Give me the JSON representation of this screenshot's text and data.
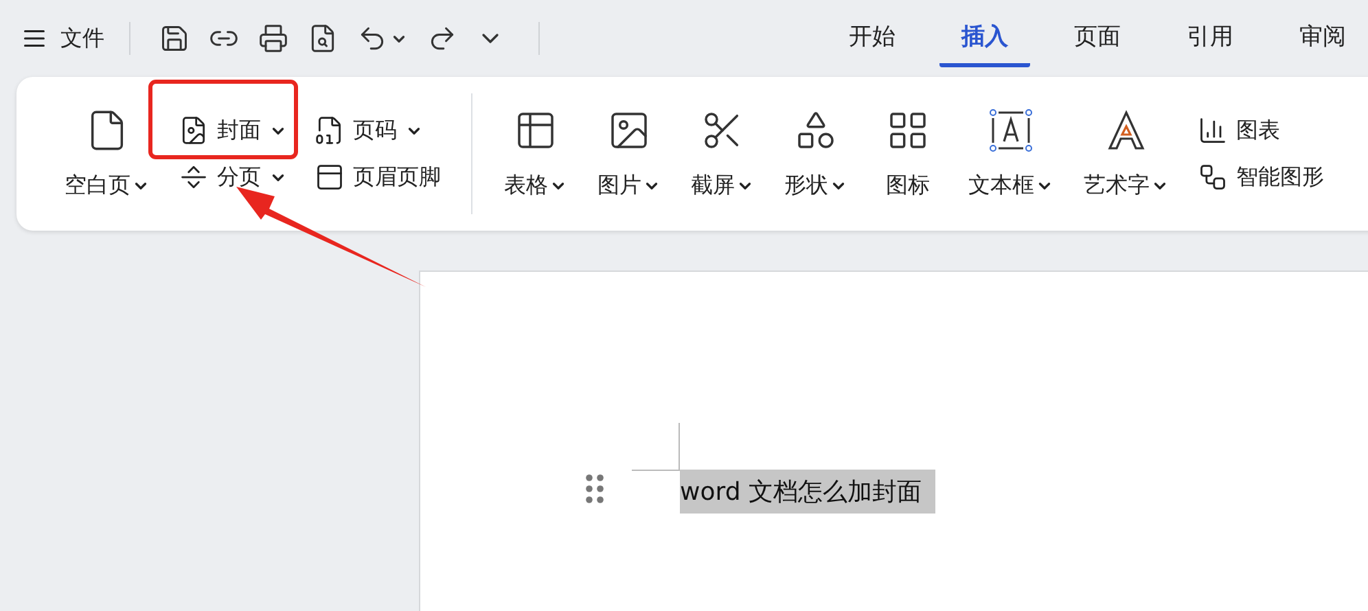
{
  "menu": {
    "label": "文件"
  },
  "tabs": [
    {
      "label": "开始",
      "selected": false
    },
    {
      "label": "插入",
      "selected": true
    },
    {
      "label": "页面",
      "selected": false
    },
    {
      "label": "引用",
      "selected": false
    },
    {
      "label": "审阅",
      "selected": false
    }
  ],
  "ribbon": {
    "items": [
      {
        "kind": "large",
        "label": "空白页",
        "dropdown": true
      },
      {
        "kind": "stack",
        "items": [
          {
            "label": "封面",
            "dropdown": true
          },
          {
            "label": "分页",
            "dropdown": true
          }
        ]
      },
      {
        "kind": "stack",
        "items": [
          {
            "label": "页码",
            "dropdown": true
          },
          {
            "label": "页眉页脚",
            "dropdown": false
          }
        ]
      },
      {
        "kind": "divider"
      },
      {
        "kind": "large",
        "label": "表格",
        "dropdown": true
      },
      {
        "kind": "large",
        "label": "图片",
        "dropdown": true
      },
      {
        "kind": "large",
        "label": "截屏",
        "dropdown": true
      },
      {
        "kind": "large",
        "label": "形状",
        "dropdown": true
      },
      {
        "kind": "large",
        "label": "图标",
        "dropdown": false
      },
      {
        "kind": "large",
        "label": "文本框",
        "dropdown": true
      },
      {
        "kind": "large",
        "label": "艺术字",
        "dropdown": true
      },
      {
        "kind": "stack",
        "items": [
          {
            "label": "图表",
            "dropdown": false
          },
          {
            "label": "智能图形",
            "dropdown": false
          }
        ]
      }
    ]
  },
  "document": {
    "text": "word 文档怎么加封面",
    "selected": true
  }
}
